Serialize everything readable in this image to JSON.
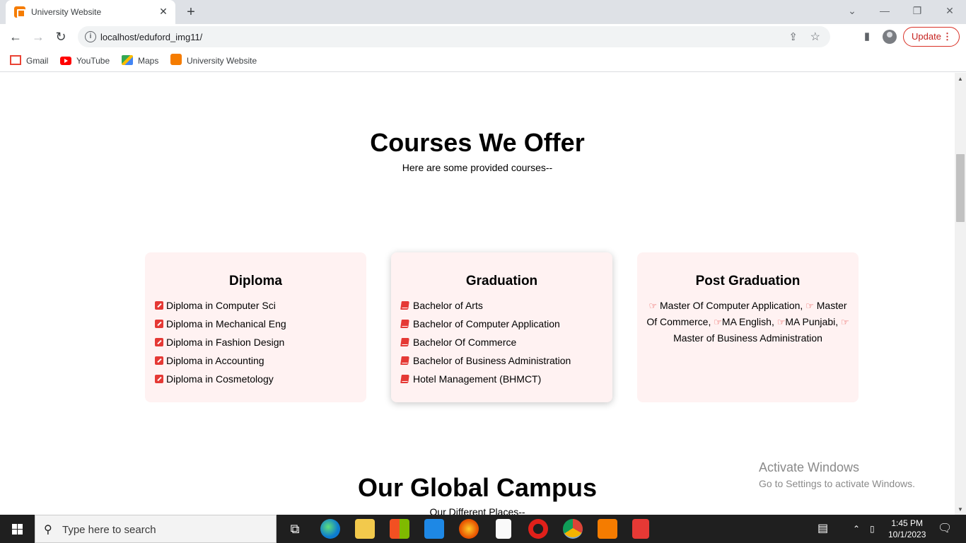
{
  "browser": {
    "tab_title": "University Website",
    "url": "localhost/eduford_img11/",
    "update_label": "Update",
    "bookmarks": [
      {
        "label": "Gmail",
        "icon": "gmail-icon"
      },
      {
        "label": "YouTube",
        "icon": "youtube-icon"
      },
      {
        "label": "Maps",
        "icon": "maps-icon"
      },
      {
        "label": "University Website",
        "icon": "university-icon"
      }
    ]
  },
  "courses": {
    "title": "Courses We Offer",
    "subtitle": "Here are some provided courses--",
    "cards": [
      {
        "title": "Diploma",
        "icon": "edit-square-icon",
        "items": [
          "Diploma in Computer Sci",
          "Diploma in Mechanical Eng",
          "Diploma in Fashion Design",
          "Diploma in Accounting",
          "Diploma in Cosmetology"
        ]
      },
      {
        "title": "Graduation",
        "icon": "book-icon",
        "items": [
          "Bachelor of Arts",
          "Bachelor of Computer Application",
          "Bachelor Of Commerce",
          "Bachelor of Business Administration",
          "Hotel Management (BHMCT)"
        ]
      },
      {
        "title": "Post Graduation",
        "icon": "hand-pointer-icon",
        "items": [
          "Master Of Computer Application,",
          "Master Of Commerce,",
          "MA English,",
          "MA Punjabi,",
          "Master of Business Administration"
        ]
      }
    ]
  },
  "campus": {
    "title": "Our Global Campus",
    "subtitle": "Our Different Places--"
  },
  "watermark": {
    "line1": "Activate Windows",
    "line2": "Go to Settings to activate Windows."
  },
  "taskbar": {
    "search_placeholder": "Type here to search",
    "time": "1:45 PM",
    "date": "10/1/2023"
  },
  "colors": {
    "card_bg": "#fff2f2",
    "icon_red": "#e53935",
    "update_red": "#d93025"
  }
}
